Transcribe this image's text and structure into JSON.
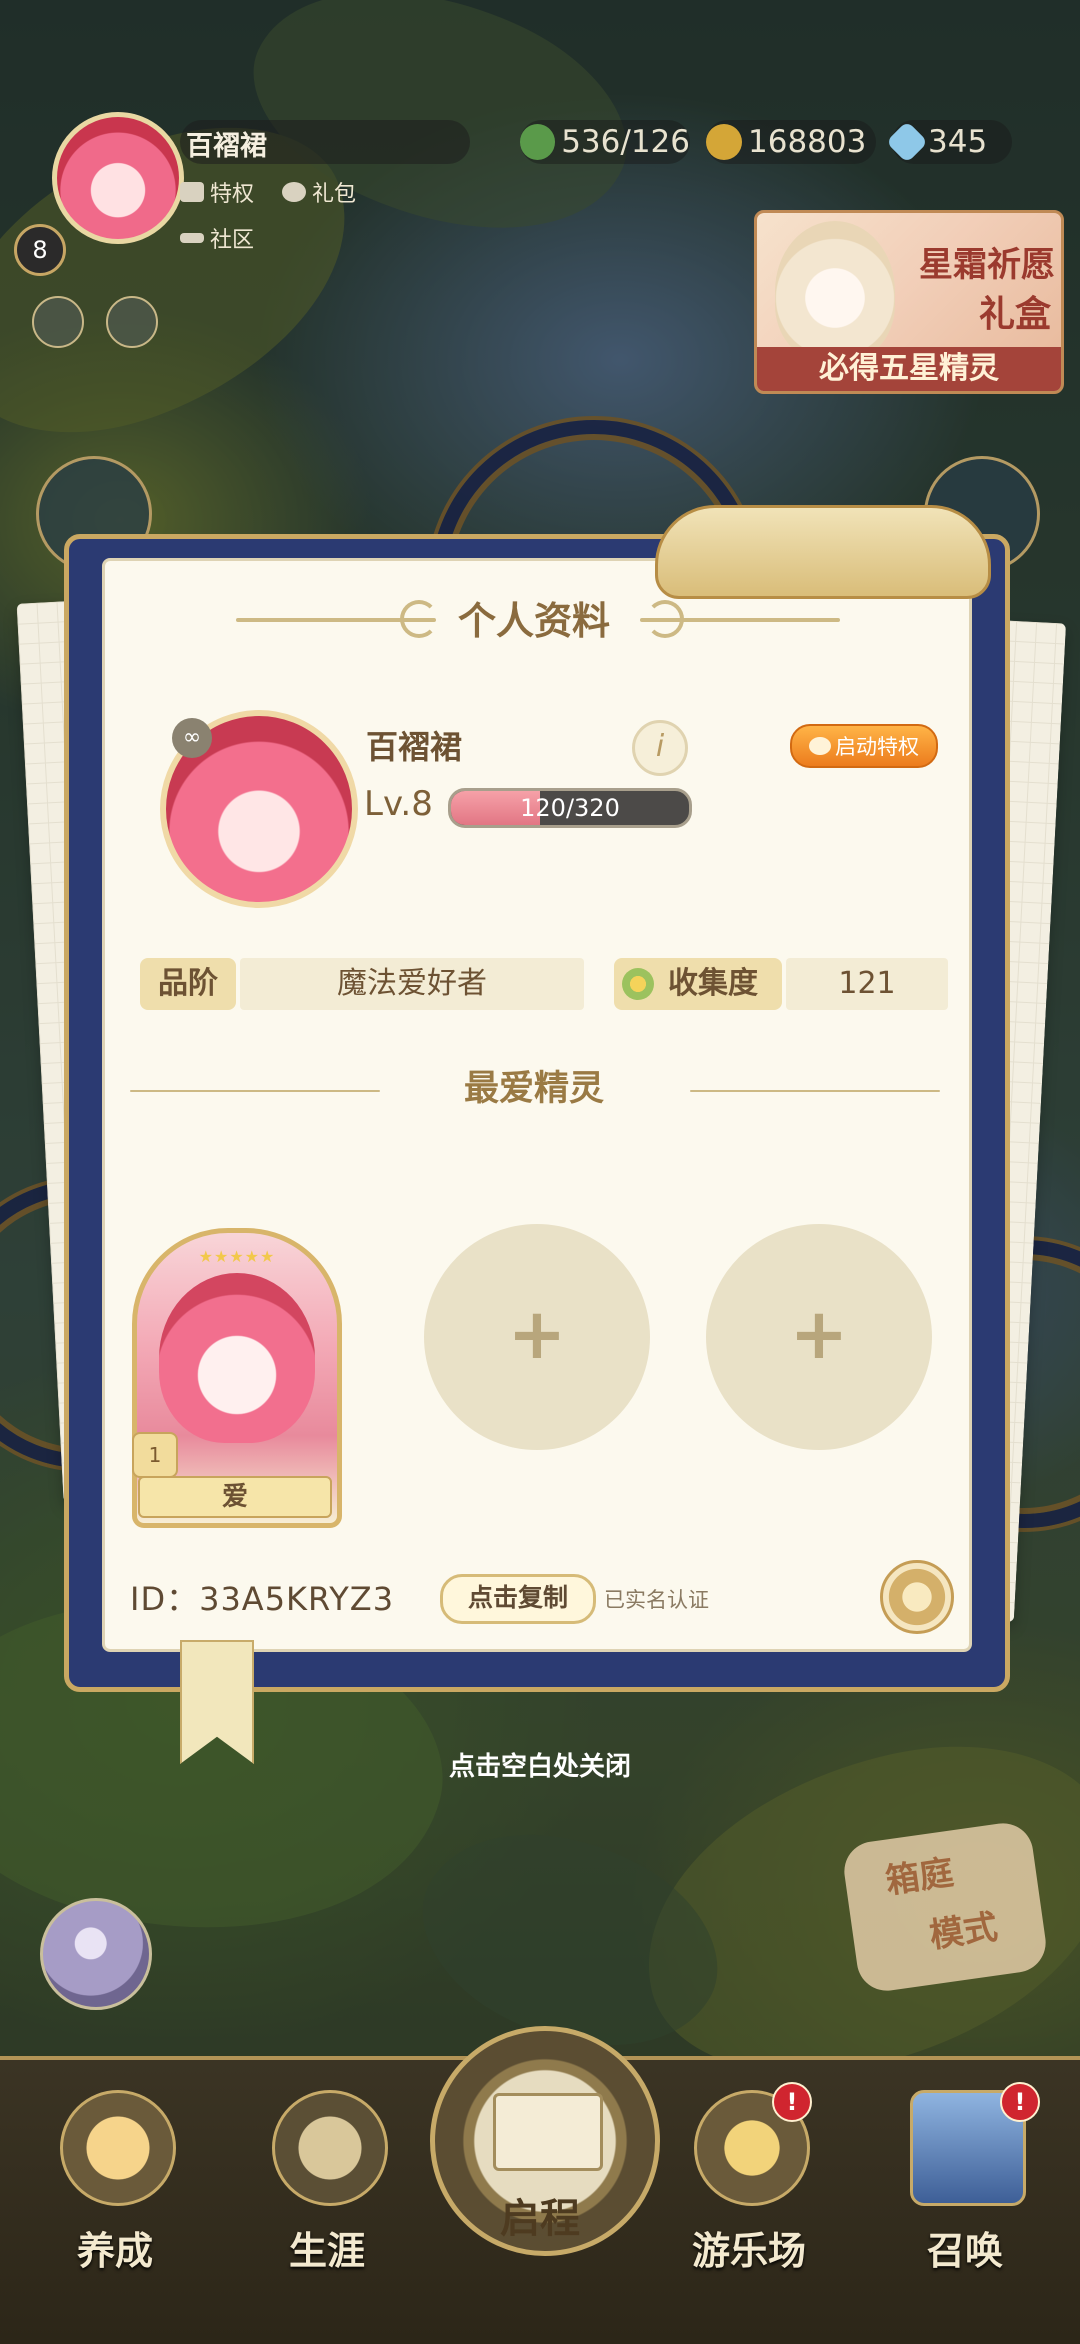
{
  "player": {
    "name": "百褶裙",
    "hud_level": "8",
    "links": {
      "privilege": "特权",
      "gift": "礼包",
      "community": "社区"
    }
  },
  "currencies": [
    {
      "icon": "clover-icon",
      "value": "536/126",
      "color": "#5a9a4a"
    },
    {
      "icon": "gold-coin-icon",
      "value": "168803",
      "color": "#d4a637"
    },
    {
      "icon": "diamond-icon",
      "value": "345",
      "color": "#8ec8e8"
    }
  ],
  "promo": {
    "line1": "星霜祈愿",
    "line2": "礼盒",
    "banner": "必得五星精灵"
  },
  "profile": {
    "title": "个人资料",
    "name": "百褶裙",
    "level_label": "Lv.8",
    "xp_text": "120/320",
    "xp_fraction": 0.375,
    "privilege_button": "启动特权",
    "rank_label": "品阶",
    "rank_value": "魔法爱好者",
    "collection_label": "收集度",
    "collection_value": "121",
    "favorites_title": "最爱精灵",
    "favorite": {
      "stars": "★★★★★",
      "level": "1",
      "name": "爱"
    },
    "add_slot_symbol": "+",
    "id_text": "ID：33A5KRYZ3",
    "copy_button": "点击复制",
    "verified_text": "已实名认证"
  },
  "close_hint": "点击空白处关闭",
  "yard_mode": {
    "line1": "箱庭",
    "line2": "模式"
  },
  "nav": [
    {
      "label": "养成",
      "icon": "raise-icon",
      "badge": ""
    },
    {
      "label": "生涯",
      "icon": "crown-icon",
      "badge": ""
    },
    {
      "label": "启程",
      "icon": "book-icon",
      "badge": ""
    },
    {
      "label": "游乐场",
      "icon": "star-badge-icon",
      "badge": "!"
    },
    {
      "label": "召唤",
      "icon": "card-icon",
      "badge": "!"
    }
  ]
}
